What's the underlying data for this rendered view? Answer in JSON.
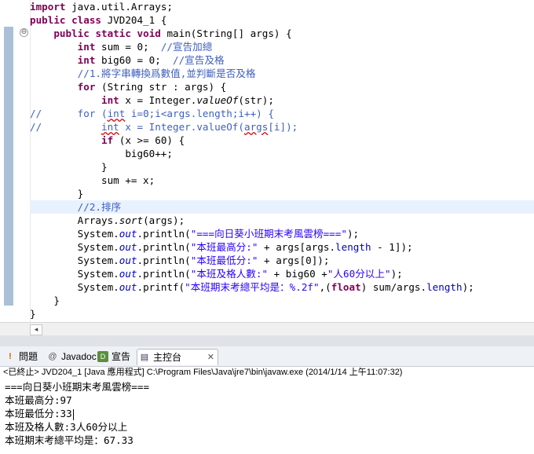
{
  "editor": {
    "lines": [
      {
        "gutter": "",
        "parts": [
          {
            "t": "import",
            "c": "kw"
          },
          {
            "t": " java.util.Arrays;",
            "c": ""
          }
        ]
      },
      {
        "gutter": "",
        "parts": [
          {
            "t": "public",
            "c": "kw"
          },
          {
            "t": " ",
            "c": ""
          },
          {
            "t": "class",
            "c": "kw"
          },
          {
            "t": " JVD204_1 {",
            "c": ""
          }
        ]
      },
      {
        "gutter": "",
        "parts": [
          {
            "t": "    ",
            "c": ""
          },
          {
            "t": "public",
            "c": "kw"
          },
          {
            "t": " ",
            "c": ""
          },
          {
            "t": "static",
            "c": "kw"
          },
          {
            "t": " ",
            "c": ""
          },
          {
            "t": "void",
            "c": "kw"
          },
          {
            "t": " main(String[] args) {",
            "c": ""
          }
        ]
      },
      {
        "gutter": "",
        "parts": [
          {
            "t": "        ",
            "c": ""
          },
          {
            "t": "int",
            "c": "kw"
          },
          {
            "t": " sum = 0;  ",
            "c": ""
          },
          {
            "t": "//宣告加總",
            "c": "cm"
          }
        ]
      },
      {
        "gutter": "",
        "parts": [
          {
            "t": "        ",
            "c": ""
          },
          {
            "t": "int",
            "c": "kw"
          },
          {
            "t": " big60 = 0;  ",
            "c": ""
          },
          {
            "t": "//宣告及格",
            "c": "cm"
          }
        ]
      },
      {
        "gutter": "",
        "parts": [
          {
            "t": "        ",
            "c": ""
          },
          {
            "t": "//1.將字串轉換爲數值,並判斷是否及格",
            "c": "cm"
          }
        ]
      },
      {
        "gutter": "",
        "parts": [
          {
            "t": "        ",
            "c": ""
          },
          {
            "t": "for",
            "c": "kw"
          },
          {
            "t": " (String str : args) {",
            "c": ""
          }
        ]
      },
      {
        "gutter": "",
        "parts": [
          {
            "t": "            ",
            "c": ""
          },
          {
            "t": "int",
            "c": "kw"
          },
          {
            "t": " x = Integer.",
            "c": ""
          },
          {
            "t": "valueOf",
            "c": "it"
          },
          {
            "t": "(str);",
            "c": ""
          }
        ]
      },
      {
        "gutter": "//",
        "parts": [
          {
            "t": "        ",
            "c": ""
          },
          {
            "t": "for (",
            "c": "cm"
          },
          {
            "t": "int",
            "c": "cm squig"
          },
          {
            "t": " i=0;i<args.length;i++) {",
            "c": "cm"
          }
        ]
      },
      {
        "gutter": "//",
        "parts": [
          {
            "t": "            ",
            "c": ""
          },
          {
            "t": "int",
            "c": "cm squig"
          },
          {
            "t": " x = Integer.valueOf(",
            "c": "cm"
          },
          {
            "t": "args",
            "c": "cm squig"
          },
          {
            "t": "[i]);",
            "c": "cm"
          }
        ]
      },
      {
        "gutter": "",
        "parts": [
          {
            "t": "            ",
            "c": ""
          },
          {
            "t": "if",
            "c": "kw"
          },
          {
            "t": " (x >= 60) {",
            "c": ""
          }
        ]
      },
      {
        "gutter": "",
        "parts": [
          {
            "t": "                big60++;",
            "c": ""
          }
        ]
      },
      {
        "gutter": "",
        "parts": [
          {
            "t": "            }",
            "c": ""
          }
        ]
      },
      {
        "gutter": "",
        "parts": [
          {
            "t": "            sum += x;",
            "c": ""
          }
        ]
      },
      {
        "gutter": "",
        "parts": [
          {
            "t": "        }",
            "c": ""
          }
        ]
      },
      {
        "gutter": "",
        "parts": [
          {
            "t": "        ",
            "c": ""
          },
          {
            "t": "//2.排序",
            "c": "cm"
          }
        ]
      },
      {
        "gutter": "",
        "parts": [
          {
            "t": "        Arrays.",
            "c": ""
          },
          {
            "t": "sort",
            "c": "it"
          },
          {
            "t": "(args);",
            "c": ""
          }
        ]
      },
      {
        "gutter": "",
        "parts": [
          {
            "t": "        System.",
            "c": ""
          },
          {
            "t": "out",
            "c": "fld"
          },
          {
            "t": ".println(",
            "c": ""
          },
          {
            "t": "\"===向日葵小班期末考風雲榜===\"",
            "c": "str"
          },
          {
            "t": ");",
            "c": ""
          }
        ]
      },
      {
        "gutter": "",
        "parts": [
          {
            "t": "        System.",
            "c": ""
          },
          {
            "t": "out",
            "c": "fld"
          },
          {
            "t": ".println(",
            "c": ""
          },
          {
            "t": "\"本班最高分:\"",
            "c": "str"
          },
          {
            "t": " + args[args.",
            "c": ""
          },
          {
            "t": "length",
            "c": "fld2"
          },
          {
            "t": " - 1]);",
            "c": ""
          }
        ]
      },
      {
        "gutter": "",
        "parts": [
          {
            "t": "        System.",
            "c": ""
          },
          {
            "t": "out",
            "c": "fld"
          },
          {
            "t": ".println(",
            "c": ""
          },
          {
            "t": "\"本班最低分:\"",
            "c": "str"
          },
          {
            "t": " + args[0]);",
            "c": ""
          }
        ]
      },
      {
        "gutter": "",
        "parts": [
          {
            "t": "        System.",
            "c": ""
          },
          {
            "t": "out",
            "c": "fld"
          },
          {
            "t": ".println(",
            "c": ""
          },
          {
            "t": "\"本班及格人數:\"",
            "c": "str"
          },
          {
            "t": " + big60 +",
            "c": ""
          },
          {
            "t": "\"人60分以上\"",
            "c": "str"
          },
          {
            "t": ");",
            "c": ""
          }
        ]
      },
      {
        "gutter": "",
        "parts": [
          {
            "t": "        System.",
            "c": ""
          },
          {
            "t": "out",
            "c": "fld"
          },
          {
            "t": ".printf(",
            "c": ""
          },
          {
            "t": "\"本班期末考總平均是：%.2f\"",
            "c": "str"
          },
          {
            "t": ",(",
            "c": ""
          },
          {
            "t": "float",
            "c": "kw"
          },
          {
            "t": ") sum/args.",
            "c": ""
          },
          {
            "t": "length",
            "c": "fld2"
          },
          {
            "t": ");",
            "c": ""
          }
        ]
      },
      {
        "gutter": "",
        "parts": [
          {
            "t": "    }",
            "c": ""
          }
        ]
      },
      {
        "gutter": "",
        "parts": [
          {
            "t": "}",
            "c": ""
          }
        ]
      }
    ],
    "fold_marker": "⊖"
  },
  "tabs": [
    {
      "label": "問題",
      "icon": "problems-icon",
      "glyph": "!",
      "active": false
    },
    {
      "label": "Javadoc",
      "icon": "javadoc-icon",
      "glyph": "@",
      "active": false
    },
    {
      "label": "宣告",
      "icon": "declaration-icon",
      "glyph": "D",
      "active": false
    },
    {
      "label": "主控台",
      "icon": "console-icon",
      "glyph": "▤",
      "active": true,
      "close": "✕"
    }
  ],
  "console": {
    "header": "<已終止> JVD204_1 [Java 應用程式] C:\\Program Files\\Java\\jre7\\bin\\javaw.exe (2014/1/14 上午11:07:32)",
    "output": [
      "===向日葵小班期末考風雲榜===",
      "本班最高分:97",
      "本班最低分:33",
      "本班及格人數:3人60分以上",
      "本班期末考總平均是：67.33"
    ]
  },
  "colors": {
    "keyword": "#7f0055",
    "comment": "#3f5fbf",
    "string": "#2a00ff",
    "field": "#0000c0",
    "current_line": "#e8f2fe",
    "change_bar": "#a9c0d8"
  }
}
